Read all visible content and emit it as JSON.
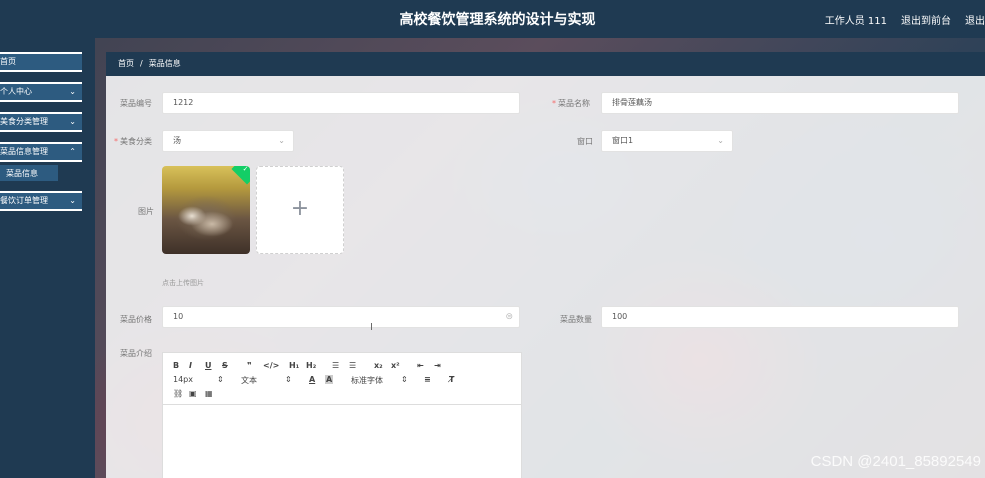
{
  "header": {
    "title": "高校餐饮管理系统的设计与实现",
    "user": "工作人员 111",
    "back_to_frontend": "退出到前台",
    "logout": "退出登录"
  },
  "sidebar": {
    "items": [
      {
        "label": "首页"
      },
      {
        "label": "个人中心"
      },
      {
        "label": "美食分类管理"
      },
      {
        "label": "菜品信息管理"
      },
      {
        "label": "菜品信息"
      },
      {
        "label": "餐饮订单管理"
      }
    ]
  },
  "breadcrumb": {
    "home": "首页",
    "separator": "/",
    "current": "菜品信息"
  },
  "form": {
    "dish_code": {
      "label": "菜品编号",
      "value": "1212"
    },
    "dish_name": {
      "label": "菜品名称",
      "value": "排骨莲藕汤"
    },
    "food_category": {
      "label": "美食分类",
      "value": "汤"
    },
    "window": {
      "label": "窗口",
      "value": "窗口1"
    },
    "image": {
      "label": "图片",
      "upload_hint": "点击上传图片"
    },
    "price": {
      "label": "菜品价格",
      "value": "10"
    },
    "quantity": {
      "label": "菜品数量",
      "value": "100"
    },
    "intro": {
      "label": "菜品介绍"
    }
  },
  "editor": {
    "bold": "B",
    "italic": "I",
    "underline": "U",
    "strike": "S",
    "quote": "❞",
    "code": "</>",
    "h1": "H₁",
    "h2": "H₂",
    "ol": "☰",
    "ul": "☰",
    "sub": "x₂",
    "sup": "x²",
    "indent_less": "⇤",
    "indent_more": "⇥",
    "font_size": "14px",
    "text_type": "文本",
    "font_color": "A",
    "bg_color": "A",
    "font_family": "标准字体",
    "align": "≡",
    "clear": "T̸",
    "link": "🔗",
    "image": "▣",
    "video": "▦"
  },
  "watermark": "CSDN @2401_85892549"
}
